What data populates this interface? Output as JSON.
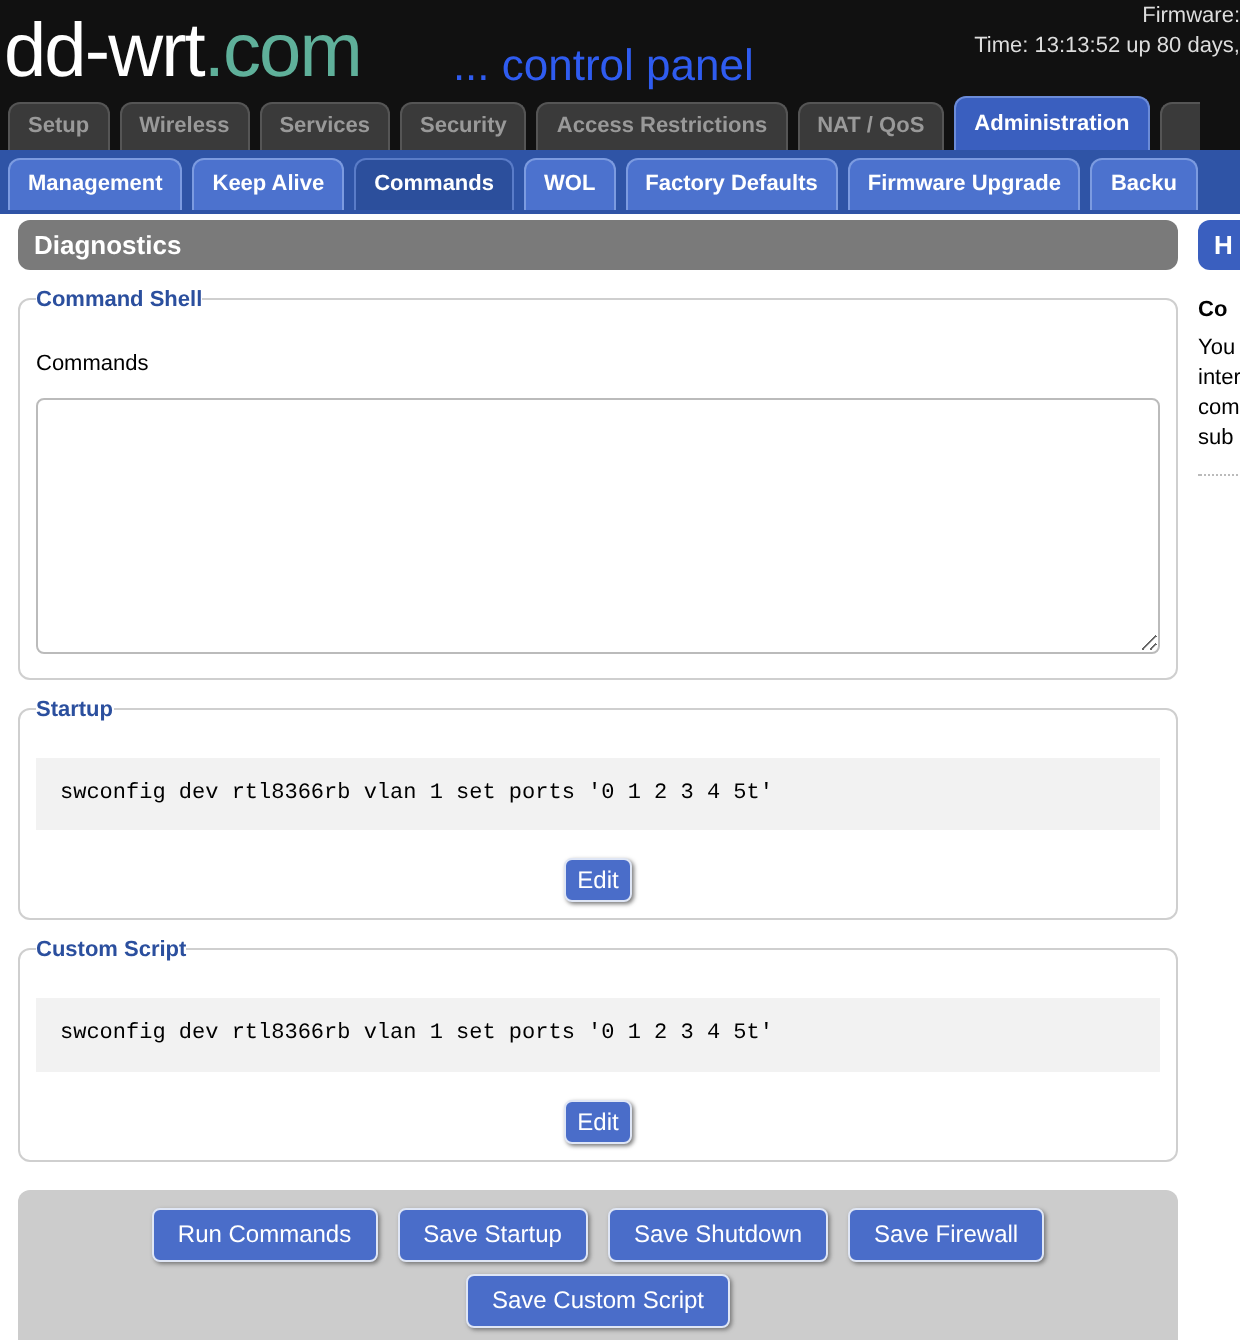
{
  "header": {
    "logo_main": "dd-wrt",
    "logo_suffix": ".com",
    "tagline": "... control panel",
    "firmware_label": "Firmware:",
    "uptime": "Time: 13:13:52 up 80 days,"
  },
  "main_tabs": [
    {
      "label": "Setup",
      "selected": false
    },
    {
      "label": "Wireless",
      "selected": false
    },
    {
      "label": "Services",
      "selected": false
    },
    {
      "label": "Security",
      "selected": false
    },
    {
      "label": "Access Restrictions",
      "selected": false
    },
    {
      "label": "NAT / QoS",
      "selected": false
    },
    {
      "label": "Administration",
      "selected": true
    }
  ],
  "sub_tabs": [
    {
      "label": "Management",
      "selected": false
    },
    {
      "label": "Keep Alive",
      "selected": false
    },
    {
      "label": "Commands",
      "selected": true
    },
    {
      "label": "WOL",
      "selected": false
    },
    {
      "label": "Factory Defaults",
      "selected": false
    },
    {
      "label": "Firmware Upgrade",
      "selected": false
    },
    {
      "label": "Backu",
      "selected": false
    }
  ],
  "section_title": "Diagnostics",
  "command_shell": {
    "legend": "Command Shell",
    "label": "Commands"
  },
  "startup": {
    "legend": "Startup",
    "code": "swconfig dev rtl8366rb vlan 1 set ports '0 1 2 3 4 5t'",
    "button": "Edit"
  },
  "custom_script": {
    "legend": "Custom Script",
    "code": "swconfig dev rtl8366rb vlan 1 set ports '0 1 2 3 4 5t'",
    "button": "Edit"
  },
  "buttons": [
    "Run Commands",
    "Save Startup",
    "Save Shutdown",
    "Save Firewall",
    "Save Custom Script"
  ],
  "help": {
    "button": "H",
    "title": "Co",
    "lines": [
      "You",
      "inter",
      "com",
      "sub"
    ]
  }
}
